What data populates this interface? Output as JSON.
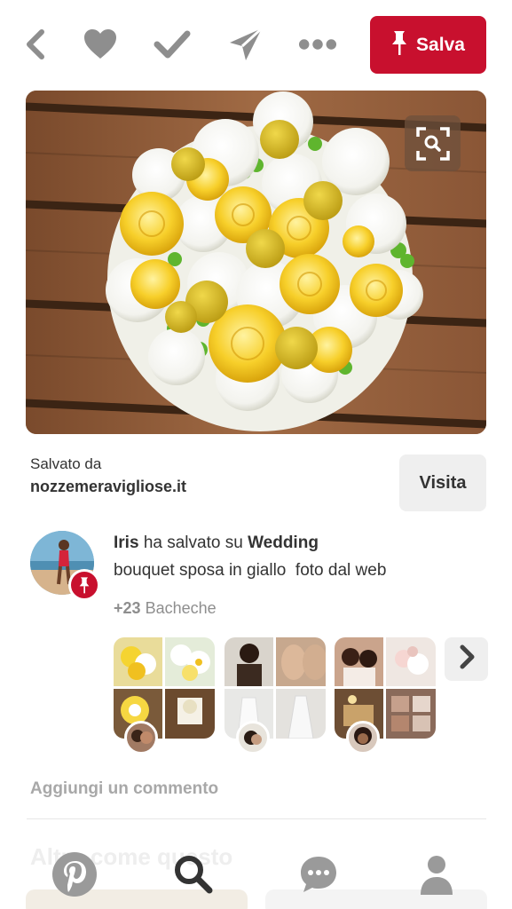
{
  "toolbar": {
    "back_icon": "chevron-left-icon",
    "like_icon": "heart-icon",
    "done_icon": "checkmark-icon",
    "send_icon": "paper-plane-icon",
    "more_icon": "ellipsis-icon",
    "save_label": "Salva",
    "icon_color": "#8e8e8e",
    "save_color": "#c8102e"
  },
  "pin": {
    "image_icon": "visual-search-icon"
  },
  "source": {
    "label": "Salvato da",
    "domain": "nozzemeravigliose.it",
    "visit_label": "Visita"
  },
  "saver": {
    "name": "Iris",
    "action": "ha salvato su",
    "board": "Wedding",
    "description": "bouquet sposa in giallo  foto dal web",
    "boards_count": "+23",
    "boards_label": "Bacheche"
  },
  "comment": {
    "placeholder": "Aggiungi un commento"
  },
  "ghost": {
    "text": "Altro come questo"
  },
  "bottom_nav": [
    {
      "name": "home",
      "icon": "pinterest-logo-icon"
    },
    {
      "name": "search",
      "icon": "search-icon"
    },
    {
      "name": "messages",
      "icon": "chat-bubble-icon"
    },
    {
      "name": "profile",
      "icon": "person-icon"
    }
  ]
}
